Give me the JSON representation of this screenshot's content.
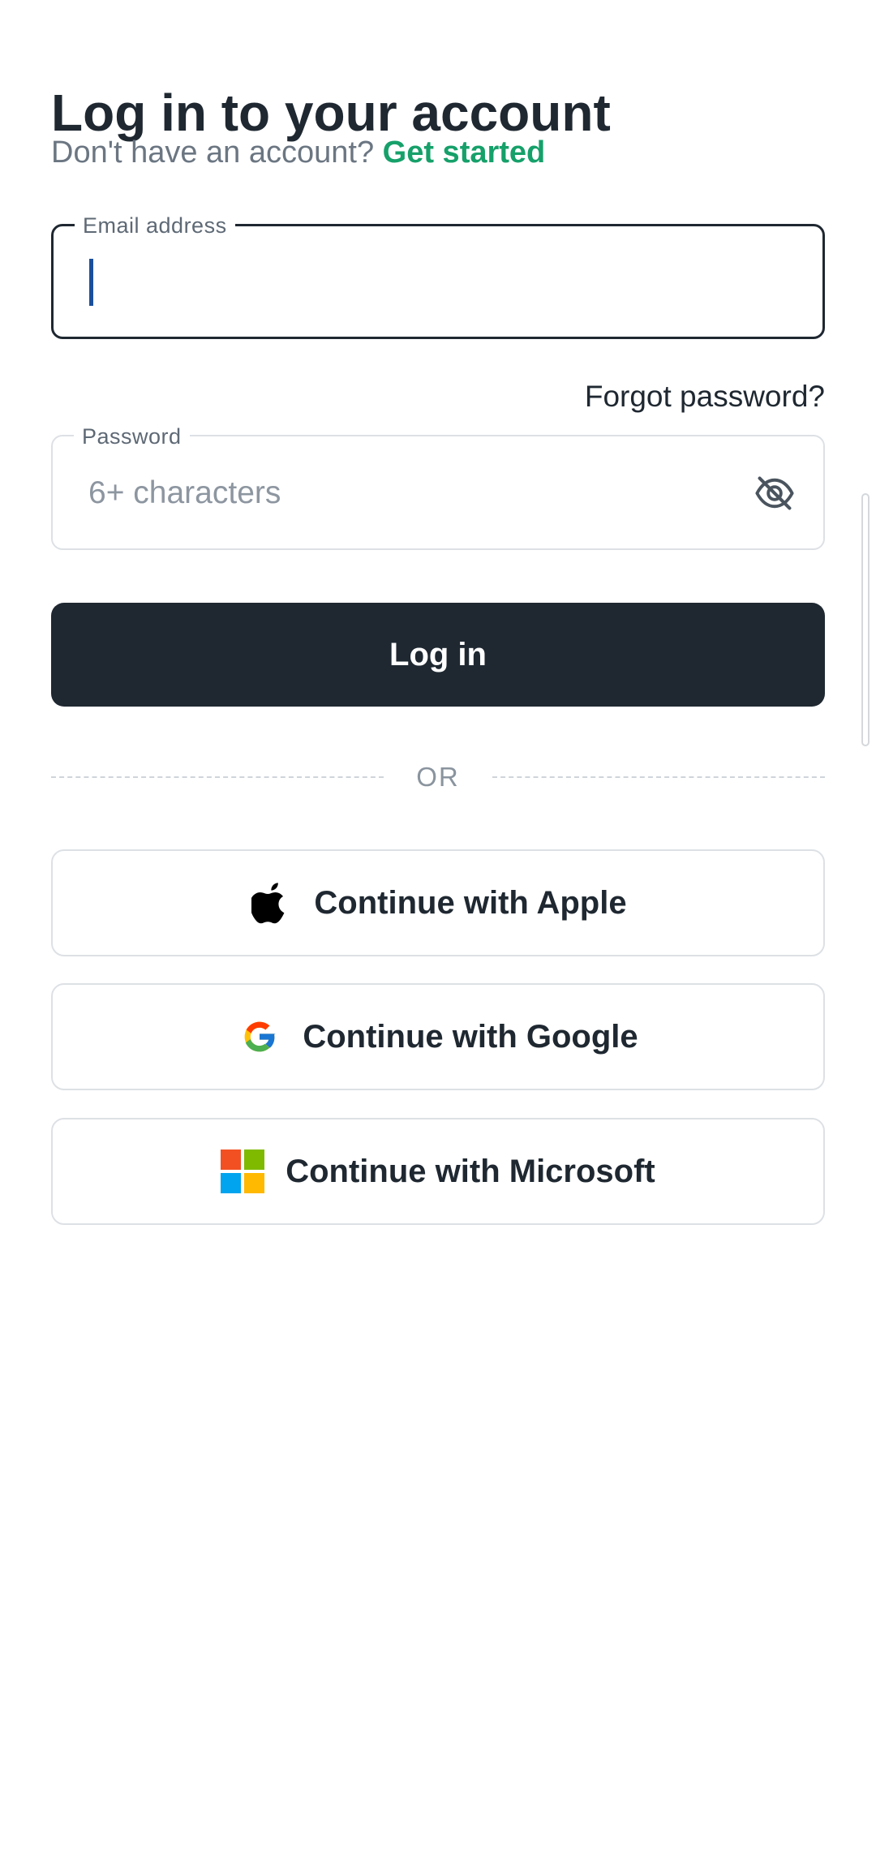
{
  "header": {
    "title": "Log in to your account",
    "prompt_text": "Don't have an account?",
    "get_started_label": "Get started"
  },
  "email_field": {
    "label": "Email address",
    "value": "",
    "placeholder": ""
  },
  "forgot_password_label": "Forgot password?",
  "password_field": {
    "label": "Password",
    "value": "",
    "placeholder": "6+ characters",
    "visibility_icon": "eye-off-icon"
  },
  "login_button_label": "Log in",
  "divider_label": "OR",
  "social_buttons": [
    {
      "label": "Continue with Apple",
      "icon": "apple-icon"
    },
    {
      "label": "Continue with Google",
      "icon": "google-icon"
    },
    {
      "label": "Continue with Microsoft",
      "icon": "microsoft-icon"
    }
  ],
  "colors": {
    "primary_text": "#1f2831",
    "link_green": "#16a06a",
    "muted_text": "#6b7682",
    "border": "#dde1e5",
    "caret_blue": "#1b4f9c"
  }
}
